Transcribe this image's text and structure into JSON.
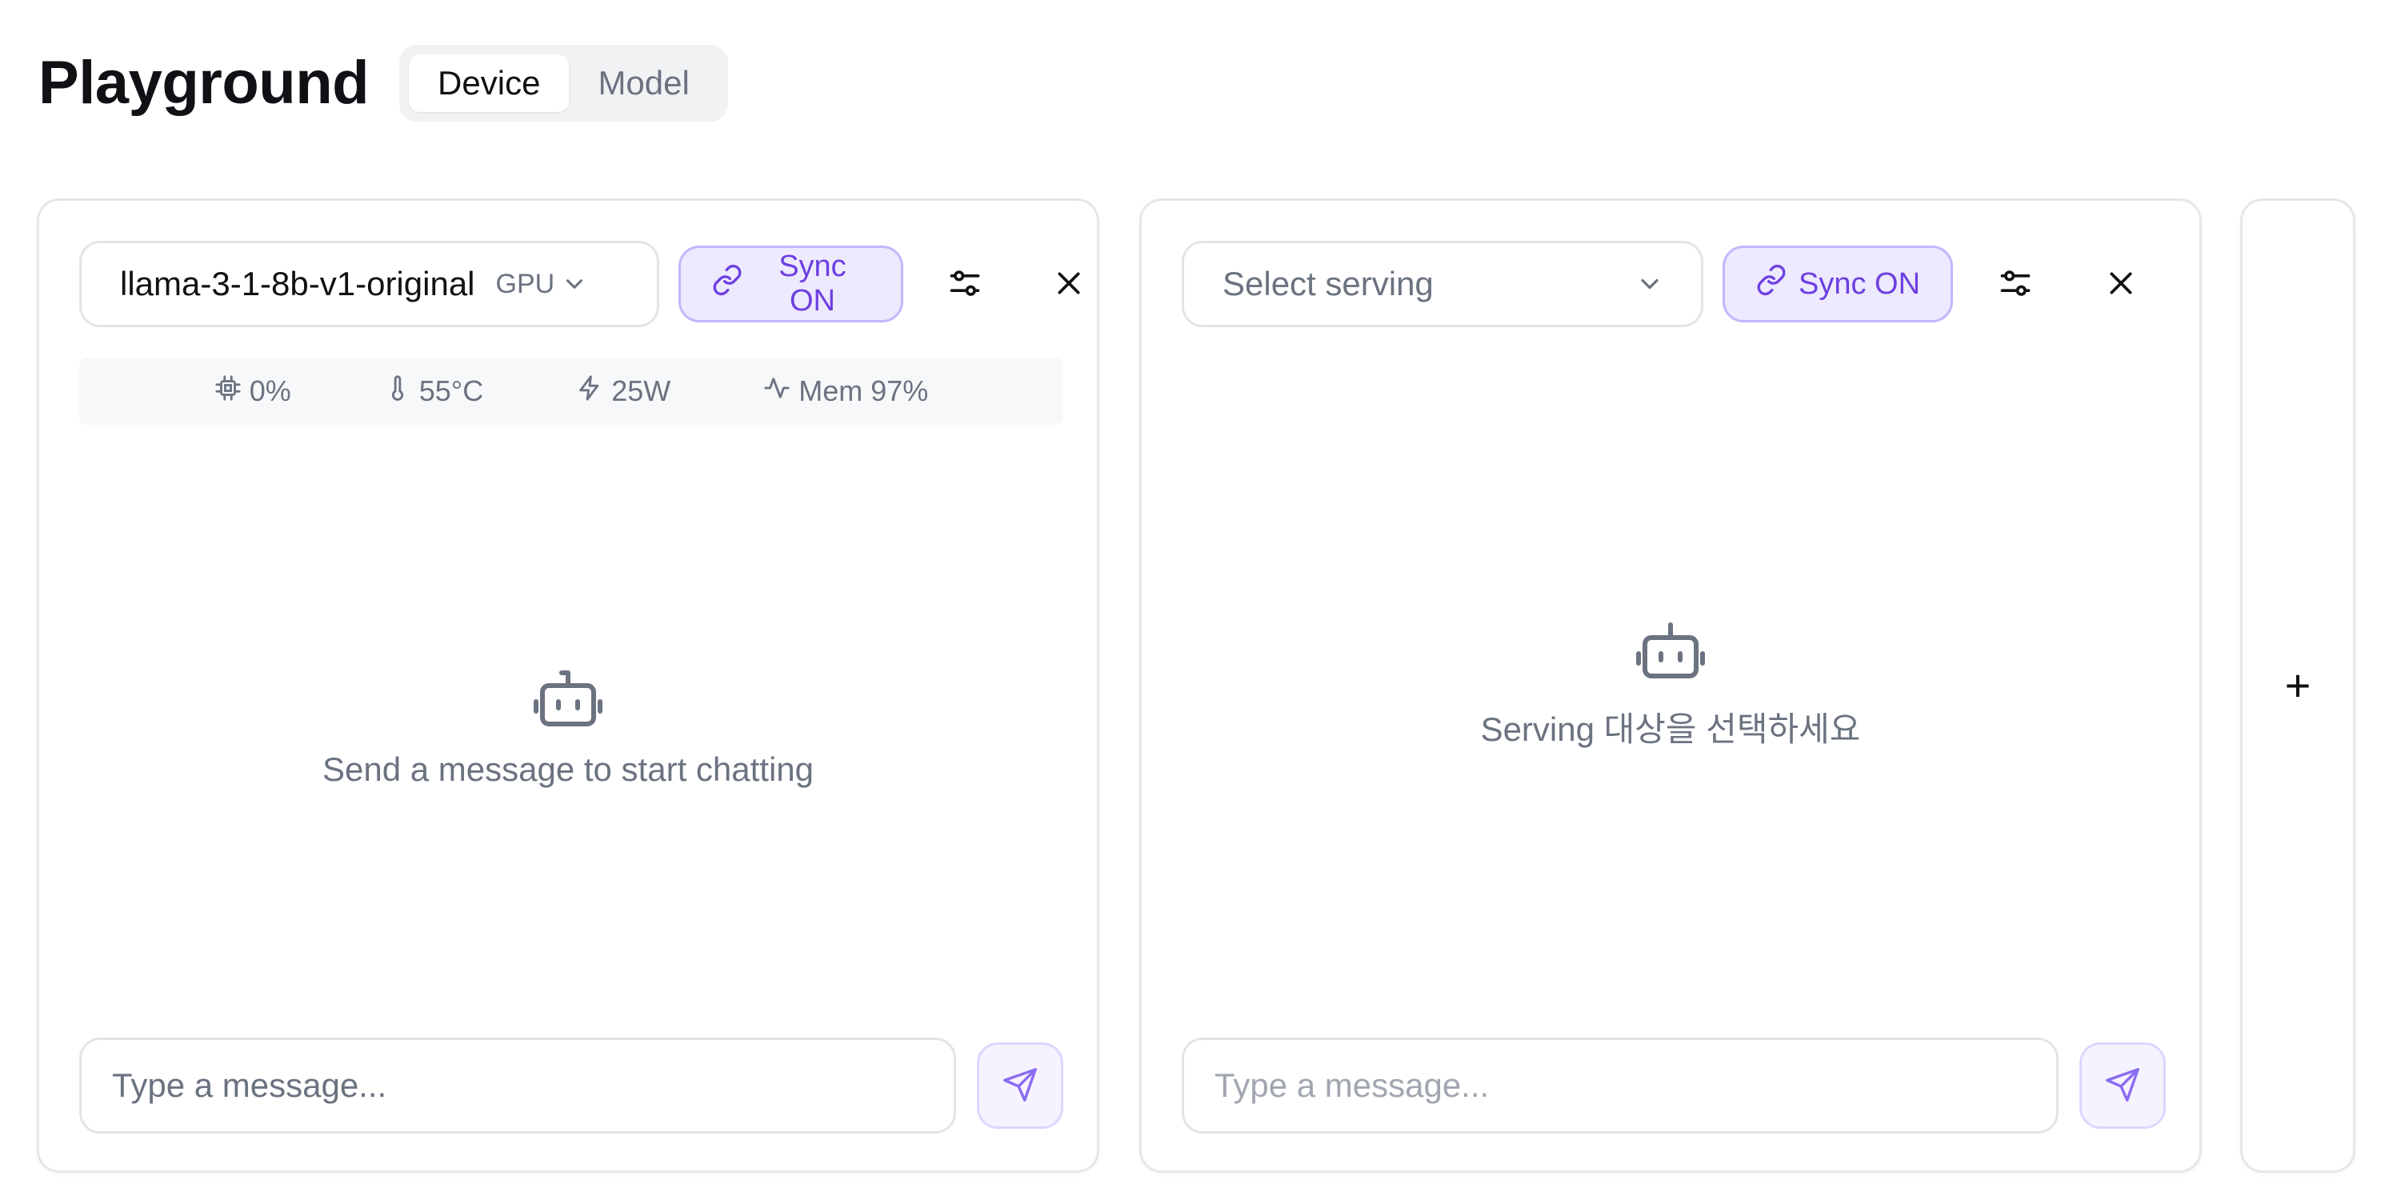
{
  "header": {
    "title": "Playground",
    "tabs": [
      {
        "label": "Device",
        "active": true
      },
      {
        "label": "Model",
        "active": false
      }
    ]
  },
  "panels": [
    {
      "selected_model": "llama-3-1-8b-v1-original",
      "device_tag": "GPU",
      "sync_label": "Sync ON",
      "stats": {
        "gpu_util": "0%",
        "temperature": "55°C",
        "power": "25W",
        "memory": "Mem 97%"
      },
      "empty_message": "Send a message to start chatting",
      "input_placeholder": "Type a message..."
    },
    {
      "select_placeholder": "Select serving",
      "sync_label": "Sync ON",
      "empty_message": "Serving 대상을 선택하세요",
      "input_placeholder": "Type a message..."
    }
  ],
  "add_panel_label": "+",
  "colors": {
    "accent": "#6d3fe0",
    "accent_bg": "#ede9fe",
    "muted_text": "#6b7280",
    "border": "#e6e7ea"
  },
  "icons": [
    "chip-icon",
    "thermometer-icon",
    "bolt-icon",
    "activity-icon",
    "link-icon",
    "sliders-icon",
    "close-icon",
    "bot-icon",
    "send-icon",
    "chevron-down-icon",
    "plus-icon"
  ]
}
